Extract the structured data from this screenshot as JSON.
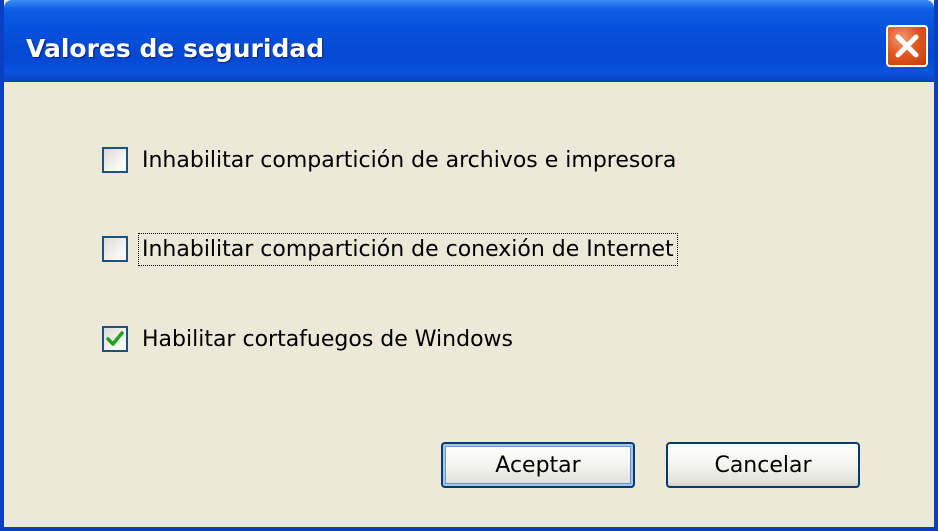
{
  "window": {
    "title": "Valores de seguridad"
  },
  "options": [
    {
      "label": "Inhabilitar compartición de archivos e impresora",
      "checked": false
    },
    {
      "label": "Inhabilitar compartición de conexión de Internet",
      "checked": false
    },
    {
      "label": "Habilitar cortafuegos de Windows",
      "checked": true
    }
  ],
  "buttons": {
    "ok_label": "Aceptar",
    "cancel_label": "Cancelar"
  },
  "icons": {
    "close": "close-icon",
    "check": "checkmark-icon"
  },
  "colors": {
    "title_bar": "#0650dc",
    "close_button": "#e2581e",
    "check_mark": "#21a121",
    "dialog_background": "#ece9d8"
  }
}
